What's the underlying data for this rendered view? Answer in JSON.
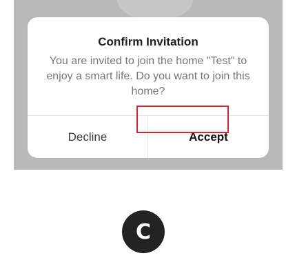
{
  "dialog": {
    "title": "Confirm Invitation",
    "message": "You are invited to join the home \"Test\" to enjoy a smart life. Do you want to join this home?",
    "decline_label": "Decline",
    "accept_label": "Accept"
  },
  "badge": {
    "letter": "C"
  },
  "colors": {
    "highlight": "#d9232e",
    "backdrop": "#b9b9b9",
    "badge": "#222222"
  }
}
